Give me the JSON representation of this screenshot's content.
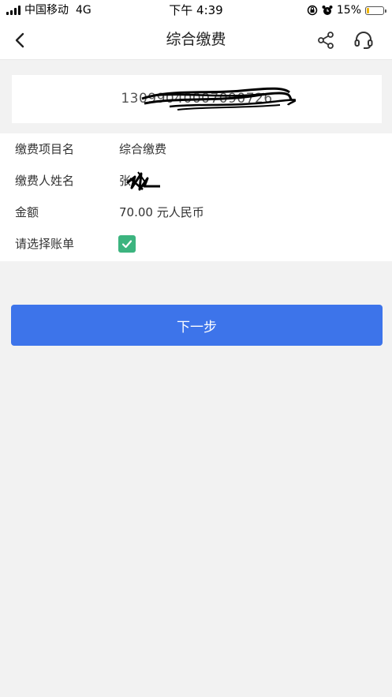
{
  "status_bar": {
    "carrier": "中国移动",
    "network": "4G",
    "time": "下午 4:39",
    "battery_percent": "15%",
    "battery_level": 0.15
  },
  "nav": {
    "title": "综合缴费"
  },
  "account": {
    "number_visible": "13099040007090726"
  },
  "info": {
    "rows": [
      {
        "label": "缴费项目名",
        "value": "综合缴费"
      },
      {
        "label": "缴费人姓名",
        "value": "张"
      },
      {
        "label": "金额",
        "value": "70.00 元人民币"
      },
      {
        "label": "请选择账单",
        "checked": true
      }
    ]
  },
  "actions": {
    "next_label": "下一步"
  },
  "colors": {
    "primary_button": "#3d74ea",
    "checkbox": "#3cb47f",
    "background": "#f2f2f2"
  },
  "icons": {
    "back": "chevron-left-icon",
    "share": "share-icon",
    "support": "headset-icon",
    "check": "check-icon"
  }
}
